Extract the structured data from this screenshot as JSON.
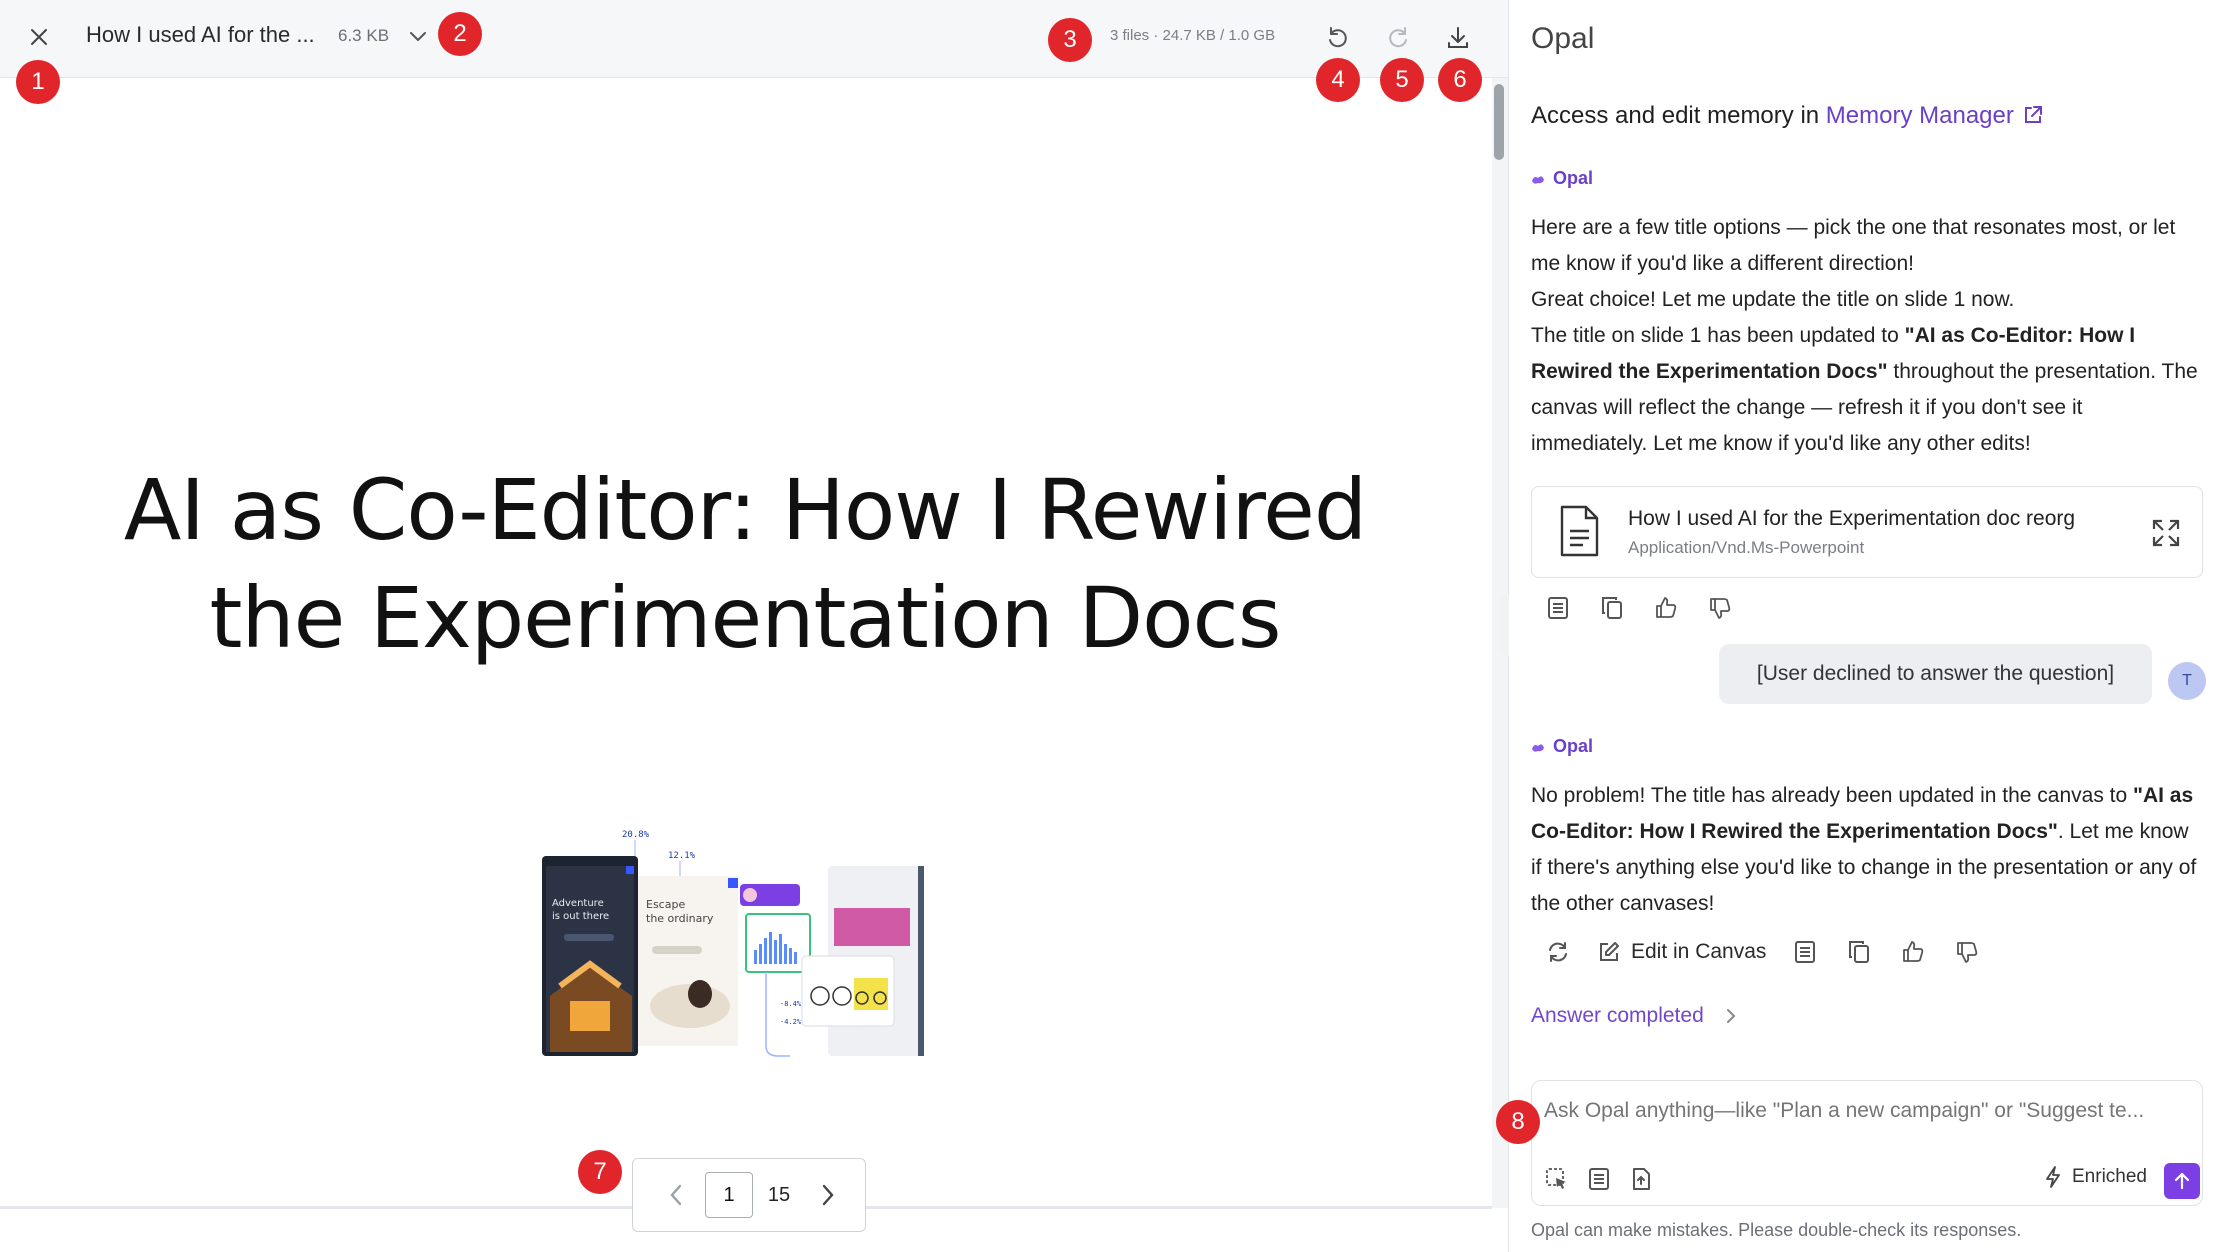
{
  "viewer": {
    "file_title": "How I used AI for the ...",
    "file_size": "6.3 KB",
    "storage": "3 files · 24.7 KB / 1.0 GB",
    "slide_title_line1": "AI as Co-Editor: How I Rewired",
    "slide_title_line2": "the Experimentation Docs",
    "pager": {
      "current": "1",
      "total": "15"
    },
    "thumb": {
      "phone1_text": "Adventure is out there",
      "phone2_text": "Escape the ordinary",
      "stat1": "20.8%",
      "stat2": "12.1%"
    }
  },
  "panel": {
    "title": "Opal",
    "memory_text": "Access and edit memory in ",
    "memory_link": "Memory Manager",
    "bot_name": "Opal",
    "msg1_p1": "Here are a few title options — pick the one that resonates most, or let me know if you'd like a different direction!",
    "msg1_p2": "Great choice! Let me update the title on slide 1 now.",
    "msg1_p3a": "The title on slide 1 has been updated to ",
    "msg1_p3b": "\"AI as Co-Editor: How I Rewired the Experimentation Docs\"",
    "msg1_p3c": " throughout the presentation. The canvas will reflect the change — refresh it if you don't see it immediately. Let me know if you'd like any other edits!",
    "file_card": {
      "name": "How I used AI for the Experimentation doc reorg",
      "type": "Application/Vnd.Ms-Powerpoint"
    },
    "user_message": "[User declined to answer the question]",
    "user_avatar": "T",
    "msg2_a": "No problem! The title has already been updated in the canvas to ",
    "msg2_b": "\"AI as Co-Editor: How I Rewired the Experimentation Docs\"",
    "msg2_c": ". Let me know if there's anything else you'd like to change in the presentation or any of the other canvases!",
    "edit_in_canvas": "Edit in Canvas",
    "answer_completed": "Answer completed",
    "composer_placeholder": "Ask Opal anything—like \"Plan a new campaign\" or \"Suggest te...",
    "enriched": "Enriched",
    "disclaimer": "Opal can make mistakes. Please double-check its responses."
  },
  "badges": [
    "1",
    "2",
    "3",
    "4",
    "5",
    "6",
    "7",
    "8"
  ],
  "colors": {
    "accent": "#6b3fc7",
    "send": "#7b3fe4",
    "badge": "#e0262b"
  },
  "icons": [
    "close-icon",
    "chevron-down-icon",
    "undo-icon",
    "redo-icon",
    "download-icon",
    "external-link-icon",
    "document-icon",
    "expand-icon",
    "notes-icon",
    "copy-icon",
    "thumbs-up-icon",
    "thumbs-down-icon",
    "refresh-icon",
    "edit-icon",
    "chevron-right-icon",
    "select-icon",
    "attach-icon",
    "lightning-icon",
    "send-arrow-icon"
  ]
}
